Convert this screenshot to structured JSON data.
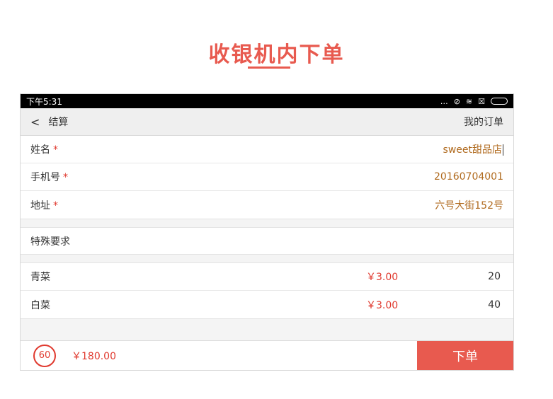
{
  "heading": "收银机内下单",
  "status": {
    "time": "下午5:31"
  },
  "nav": {
    "back_label": "结算",
    "orders_label": "我的订单"
  },
  "form": {
    "fields": [
      {
        "label": "姓名",
        "required_mark": "*",
        "value": "sweet甜品店"
      },
      {
        "label": "手机号",
        "required_mark": "*",
        "value": "20160704001"
      },
      {
        "label": "地址",
        "required_mark": "*",
        "value": "六号大街152号"
      }
    ],
    "special_label": "特殊要求"
  },
  "items": [
    {
      "name": "青菜",
      "price": "￥3.00",
      "qty": "20"
    },
    {
      "name": "白菜",
      "price": "￥3.00",
      "qty": "40"
    }
  ],
  "footer": {
    "count": "60",
    "total": "￥180.00",
    "submit_label": "下单"
  },
  "colors": {
    "accent": "#e85a4f",
    "price": "#e03a2f",
    "value": "#b06a1e"
  }
}
